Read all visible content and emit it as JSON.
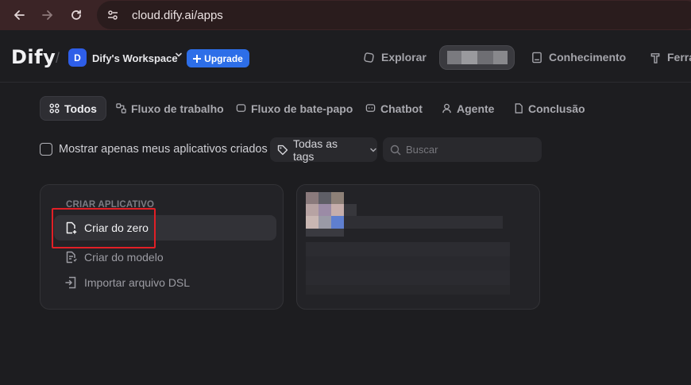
{
  "browser": {
    "url": "cloud.dify.ai/apps",
    "back_icon": "arrow-left-icon",
    "forward_icon": "arrow-right-icon",
    "reload_icon": "reload-icon"
  },
  "header": {
    "logo": "Dify",
    "workspace": {
      "avatar_letter": "D",
      "name": "Dify's Workspace"
    },
    "upgrade_label": "Upgrade",
    "nav": {
      "explore": "Explorar",
      "knowledge": "Conhecimento",
      "tools": "Ferra"
    }
  },
  "tabs": [
    {
      "label": "Todos",
      "icon": "grid-icon",
      "active": true
    },
    {
      "label": "Fluxo de trabalho",
      "icon": "workflow-icon"
    },
    {
      "label": "Fluxo de bate-papo",
      "icon": "chat-flow-icon"
    },
    {
      "label": "Chatbot",
      "icon": "chatbot-icon"
    },
    {
      "label": "Agente",
      "icon": "agent-icon"
    },
    {
      "label": "Conclusão",
      "icon": "document-icon"
    }
  ],
  "filters": {
    "only_mine_label": "Mostrar apenas meus aplicativos criados",
    "tags_label": "Todas as tags",
    "search_placeholder": "Buscar"
  },
  "create_card": {
    "heading": "CRIAR APLICATIVO",
    "items": [
      {
        "label": "Criar do zero",
        "icon": "file-plus-icon"
      },
      {
        "label": "Criar do modelo",
        "icon": "file-template-icon"
      },
      {
        "label": "Importar arquivo DSL",
        "icon": "import-icon"
      }
    ]
  },
  "colors": {
    "accent": "#2d6ee8",
    "highlight": "#e11f26",
    "browser_frame": "#3b2426",
    "background": "#1d1d20"
  }
}
